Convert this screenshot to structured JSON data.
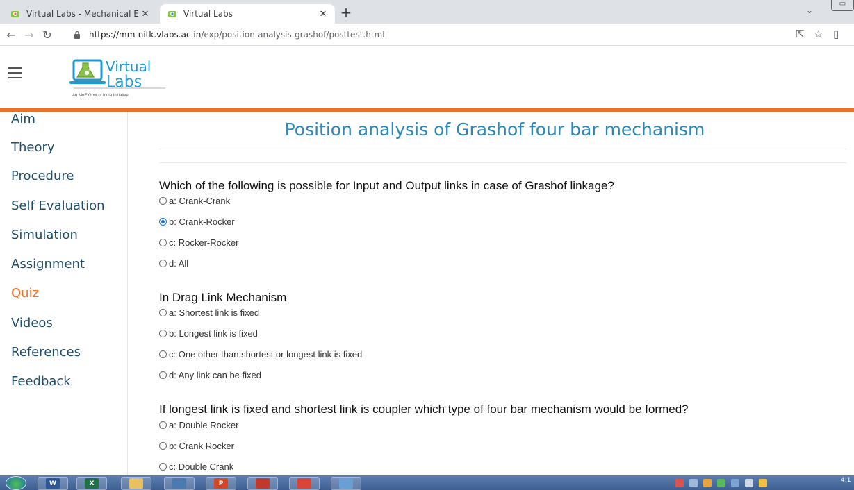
{
  "browser": {
    "tabs": [
      {
        "title": "Virtual Labs - Mechanical Engine",
        "icon": "vlabs-favicon-icon"
      },
      {
        "title": "Virtual Labs",
        "icon": "vlabs-favicon-icon"
      }
    ],
    "new_tab_symbol": "+",
    "url_host": "https://mm-nitk.vlabs.ac.in",
    "url_path": "/exp/position-analysis-grashof/posttest.html"
  },
  "header": {
    "logo_word1": "Virtual",
    "logo_word2": "Labs",
    "tagline": "An MoE Govt of India Initiative",
    "accent_color": "#f36f21"
  },
  "sidebar": {
    "items": [
      {
        "label": "Aim"
      },
      {
        "label": "Theory"
      },
      {
        "label": "Procedure"
      },
      {
        "label": "Self Evaluation"
      },
      {
        "label": "Simulation"
      },
      {
        "label": "Assignment"
      },
      {
        "label": "Quiz",
        "active": true
      },
      {
        "label": "Videos"
      },
      {
        "label": "References"
      },
      {
        "label": "Feedback"
      }
    ]
  },
  "main": {
    "title": "Position analysis of Grashof four bar mechanism",
    "questions": [
      {
        "text": "Which of the following is possible for Input and Output links in case of Grashof linkage?",
        "options": [
          "a: Crank-Crank",
          "b: Crank-Rocker",
          "c: Rocker-Rocker",
          "d: All"
        ],
        "selected": 1
      },
      {
        "text": "In Drag Link Mechanism",
        "options": [
          "a: Shortest link is fixed",
          "b: Longest link is fixed",
          "c: One other than shortest or longest link is fixed",
          "d: Any link can be fixed"
        ],
        "selected": null
      },
      {
        "text": "If longest link is fixed and shortest link is coupler which type of four bar mechanism would be formed?",
        "options": [
          "a: Double Rocker",
          "b: Crank Rocker",
          "c: Double Crank"
        ],
        "selected": null
      }
    ]
  },
  "taskbar": {
    "apps": [
      {
        "name": "word-app-icon",
        "glyph": "W",
        "color": "#2b5797"
      },
      {
        "name": "excel-app-icon",
        "glyph": "X",
        "color": "#1e7145"
      },
      {
        "name": "explorer-app-icon",
        "glyph": "",
        "color": "#e8c060"
      },
      {
        "name": "calculator-app-icon",
        "glyph": "",
        "color": "#4a7ab0"
      },
      {
        "name": "powerpoint-app-icon",
        "glyph": "P",
        "color": "#d24726"
      },
      {
        "name": "viewer-app-icon",
        "glyph": "",
        "color": "#c0392b"
      },
      {
        "name": "chrome-app-icon",
        "glyph": "",
        "color": "#db4437"
      },
      {
        "name": "paint-app-icon",
        "glyph": "",
        "color": "#6a9fd4"
      }
    ],
    "clock": "4:1"
  }
}
